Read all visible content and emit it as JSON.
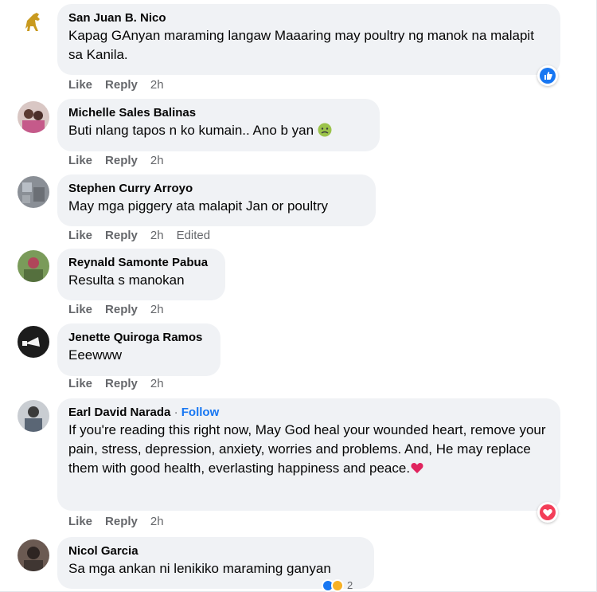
{
  "comments": [
    {
      "name": "San Juan B. Nico",
      "text": "Kapag GAnyan maraming langaw Maaaring may poultry ng manok na malapit sa Kanila.",
      "like": "Like",
      "reply": "Reply",
      "time": "2h",
      "reaction": "like-icon"
    },
    {
      "name": "Michelle Sales Balinas",
      "text": "Buti nlang tapos n ko kumain.. Ano b yan",
      "like": "Like",
      "reply": "Reply",
      "time": "2h",
      "emoji": "nauseated-face-emoji"
    },
    {
      "name": "Stephen Curry Arroyo",
      "text": "May mga piggery ata malapit Jan or poultry",
      "like": "Like",
      "reply": "Reply",
      "time": "2h",
      "edited": "Edited"
    },
    {
      "name": "Reynald Samonte Pabua",
      "text": "Resulta s manokan",
      "like": "Like",
      "reply": "Reply",
      "time": "2h"
    },
    {
      "name": "Jenette Quiroga Ramos",
      "text": "Eeewww",
      "like": "Like",
      "reply": "Reply",
      "time": "2h"
    },
    {
      "name": "Earl David Narada",
      "separator": "·",
      "follow": "Follow",
      "text": "If you're reading this right now, May God heal your wounded heart, remove your pain, stress, depression, anxiety, worries and problems. And, He may replace them with good health, everlasting happiness and peace.",
      "like": "Like",
      "reply": "Reply",
      "time": "2h",
      "reaction": "heart-icon"
    },
    {
      "name": "Nicol Garcia",
      "text": "Sa mga ankan ni lenikiko maraming ganyan",
      "reaction_count": "2"
    }
  ],
  "colors": {
    "bubble": "#f0f2f5",
    "meta": "#65676b",
    "link": "#1877f2",
    "like": "#1877f2",
    "love": "#f33e58"
  }
}
